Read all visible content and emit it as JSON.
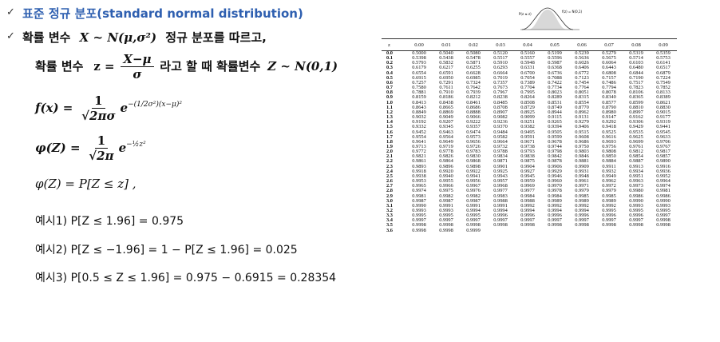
{
  "title": "표준 정규 분포(standard normal distribution)",
  "subtitle_prefix": "확률 변수",
  "subtitle_var": "X ~ N(μ,σ²)",
  "subtitle_suffix": "정규 분포를 따르고,",
  "standardize": {
    "prefix": "확률 변수",
    "lhs": "z =",
    "numerator": "X−μ",
    "denominator": "σ",
    "middle": "라고 할 때  확률변수",
    "rhs": "Z ~ N(0,1)"
  },
  "pdf": {
    "lhs": "f(x) =",
    "numerator": "1",
    "denominator": "√2πσ",
    "base": "e",
    "exponent": "−(1/2σ²)(x−μ)²"
  },
  "phi_def": {
    "lhs": "φ(Z) =",
    "numerator": "1",
    "denominator": "√2π",
    "base": "e",
    "exponent": "−½z²"
  },
  "phi_cdf": "φ(Z) = P[Z ≤ z]  ,",
  "examples": [
    "예시1) P[Z ≤ 1.96] = 0.975",
    "예시2) P[Z ≤ −1.96] = 1 − P[Z ≤ 1.96] = 0.025",
    "예시3) P[0.5 ≤ Z ≤ 1.96] = 0.975  − 0.6915 = 0.28354"
  ],
  "curve_labels": {
    "left": "P(z ≤ z)",
    "right": "f(z) = N(0,1)"
  },
  "table": {
    "corner": "z",
    "columns": [
      "0.00",
      "0.01",
      "0.02",
      "0.03",
      "0.04",
      "0.05",
      "0.06",
      "0.07",
      "0.08",
      "0.09"
    ],
    "rows": [
      [
        "0.0",
        "0.5000",
        "0.5040",
        "0.5080",
        "0.5120",
        "0.5160",
        "0.5199",
        "0.5239",
        "0.5279",
        "0.5319",
        "0.5359"
      ],
      [
        "0.1",
        "0.5398",
        "0.5438",
        "0.5478",
        "0.5517",
        "0.5557",
        "0.5596",
        "0.5636",
        "0.5675",
        "0.5714",
        "0.5753"
      ],
      [
        "0.2",
        "0.5793",
        "0.5832",
        "0.5871",
        "0.5910",
        "0.5948",
        "0.5987",
        "0.6026",
        "0.6064",
        "0.6103",
        "0.6141"
      ],
      [
        "0.3",
        "0.6179",
        "0.6217",
        "0.6255",
        "0.6293",
        "0.6331",
        "0.6368",
        "0.6406",
        "0.6443",
        "0.6480",
        "0.6517"
      ],
      [
        "0.4",
        "0.6554",
        "0.6591",
        "0.6628",
        "0.6664",
        "0.6700",
        "0.6736",
        "0.6772",
        "0.6808",
        "0.6844",
        "0.6879"
      ],
      [
        "0.5",
        "0.6915",
        "0.6950",
        "0.6985",
        "0.7019",
        "0.7054",
        "0.7088",
        "0.7123",
        "0.7157",
        "0.7190",
        "0.7224"
      ],
      [
        "0.6",
        "0.7257",
        "0.7291",
        "0.7324",
        "0.7357",
        "0.7389",
        "0.7422",
        "0.7454",
        "0.7486",
        "0.7517",
        "0.7549"
      ],
      [
        "0.7",
        "0.7580",
        "0.7611",
        "0.7642",
        "0.7673",
        "0.7704",
        "0.7734",
        "0.7764",
        "0.7794",
        "0.7823",
        "0.7852"
      ],
      [
        "0.8",
        "0.7881",
        "0.7910",
        "0.7939",
        "0.7967",
        "0.7995",
        "0.8023",
        "0.8051",
        "0.8078",
        "0.8106",
        "0.8133"
      ],
      [
        "0.9",
        "0.8159",
        "0.8186",
        "0.8212",
        "0.8238",
        "0.8264",
        "0.8289",
        "0.8315",
        "0.8340",
        "0.8365",
        "0.8389"
      ],
      [
        "1.0",
        "0.8413",
        "0.8438",
        "0.8461",
        "0.8485",
        "0.8508",
        "0.8531",
        "0.8554",
        "0.8577",
        "0.8599",
        "0.8621"
      ],
      [
        "1.1",
        "0.8643",
        "0.8665",
        "0.8686",
        "0.8708",
        "0.8729",
        "0.8749",
        "0.8770",
        "0.8790",
        "0.8810",
        "0.8830"
      ],
      [
        "1.2",
        "0.8849",
        "0.8869",
        "0.8888",
        "0.8907",
        "0.8925",
        "0.8944",
        "0.8962",
        "0.8980",
        "0.8997",
        "0.9015"
      ],
      [
        "1.3",
        "0.9032",
        "0.9049",
        "0.9066",
        "0.9082",
        "0.9099",
        "0.9115",
        "0.9131",
        "0.9147",
        "0.9162",
        "0.9177"
      ],
      [
        "1.4",
        "0.9192",
        "0.9207",
        "0.9222",
        "0.9236",
        "0.9251",
        "0.9265",
        "0.9279",
        "0.9292",
        "0.9306",
        "0.9319"
      ],
      [
        "1.5",
        "0.9332",
        "0.9345",
        "0.9357",
        "0.9370",
        "0.9382",
        "0.9394",
        "0.9406",
        "0.9418",
        "0.9429",
        "0.9441"
      ],
      [
        "1.6",
        "0.9452",
        "0.9463",
        "0.9474",
        "0.9484",
        "0.9495",
        "0.9505",
        "0.9515",
        "0.9525",
        "0.9535",
        "0.9545"
      ],
      [
        "1.7",
        "0.9554",
        "0.9564",
        "0.9573",
        "0.9582",
        "0.9591",
        "0.9599",
        "0.9608",
        "0.9616",
        "0.9625",
        "0.9633"
      ],
      [
        "1.8",
        "0.9641",
        "0.9649",
        "0.9656",
        "0.9664",
        "0.9671",
        "0.9678",
        "0.9686",
        "0.9693",
        "0.9699",
        "0.9706"
      ],
      [
        "1.9",
        "0.9713",
        "0.9719",
        "0.9726",
        "0.9732",
        "0.9738",
        "0.9744",
        "0.9750",
        "0.9756",
        "0.9761",
        "0.9767"
      ],
      [
        "2.0",
        "0.9772",
        "0.9778",
        "0.9783",
        "0.9788",
        "0.9793",
        "0.9798",
        "0.9803",
        "0.9808",
        "0.9812",
        "0.9817"
      ],
      [
        "2.1",
        "0.9821",
        "0.9826",
        "0.9830",
        "0.9834",
        "0.9838",
        "0.9842",
        "0.9846",
        "0.9850",
        "0.9854",
        "0.9857"
      ],
      [
        "2.2",
        "0.9861",
        "0.9864",
        "0.9868",
        "0.9871",
        "0.9875",
        "0.9878",
        "0.9881",
        "0.9884",
        "0.9887",
        "0.9890"
      ],
      [
        "2.3",
        "0.9893",
        "0.9896",
        "0.9898",
        "0.9901",
        "0.9904",
        "0.9906",
        "0.9909",
        "0.9911",
        "0.9913",
        "0.9916"
      ],
      [
        "2.4",
        "0.9918",
        "0.9920",
        "0.9922",
        "0.9925",
        "0.9927",
        "0.9929",
        "0.9931",
        "0.9932",
        "0.9934",
        "0.9936"
      ],
      [
        "2.5",
        "0.9938",
        "0.9940",
        "0.9941",
        "0.9943",
        "0.9945",
        "0.9946",
        "0.9948",
        "0.9949",
        "0.9951",
        "0.9952"
      ],
      [
        "2.6",
        "0.9953",
        "0.9955",
        "0.9956",
        "0.9957",
        "0.9959",
        "0.9960",
        "0.9961",
        "0.9962",
        "0.9963",
        "0.9964"
      ],
      [
        "2.7",
        "0.9965",
        "0.9966",
        "0.9967",
        "0.9968",
        "0.9969",
        "0.9970",
        "0.9971",
        "0.9972",
        "0.9973",
        "0.9974"
      ],
      [
        "2.8",
        "0.9974",
        "0.9975",
        "0.9976",
        "0.9977",
        "0.9977",
        "0.9978",
        "0.9979",
        "0.9979",
        "0.9980",
        "0.9981"
      ],
      [
        "2.9",
        "0.9981",
        "0.9982",
        "0.9982",
        "0.9983",
        "0.9984",
        "0.9984",
        "0.9985",
        "0.9985",
        "0.9986",
        "0.9986"
      ],
      [
        "3.0",
        "0.9987",
        "0.9987",
        "0.9987",
        "0.9988",
        "0.9988",
        "0.9989",
        "0.9989",
        "0.9989",
        "0.9990",
        "0.9990"
      ],
      [
        "3.1",
        "0.9990",
        "0.9991",
        "0.9991",
        "0.9991",
        "0.9992",
        "0.9992",
        "0.9992",
        "0.9992",
        "0.9993",
        "0.9993"
      ],
      [
        "3.2",
        "0.9993",
        "0.9993",
        "0.9994",
        "0.9994",
        "0.9994",
        "0.9994",
        "0.9994",
        "0.9995",
        "0.9995",
        "0.9995"
      ],
      [
        "3.3",
        "0.9995",
        "0.9995",
        "0.9995",
        "0.9996",
        "0.9996",
        "0.9996",
        "0.9996",
        "0.9996",
        "0.9996",
        "0.9997"
      ],
      [
        "3.4",
        "0.9997",
        "0.9997",
        "0.9997",
        "0.9997",
        "0.9997",
        "0.9997",
        "0.9997",
        "0.9997",
        "0.9997",
        "0.9998"
      ],
      [
        "3.5",
        "0.9998",
        "0.9998",
        "0.9998",
        "0.9998",
        "0.9998",
        "0.9998",
        "0.9998",
        "0.9998",
        "0.9998",
        "0.9998"
      ],
      [
        "3.6",
        "0.9998",
        "0.9998",
        "0.9999",
        "",
        "",
        "",
        "",
        "",
        "",
        ""
      ]
    ]
  }
}
